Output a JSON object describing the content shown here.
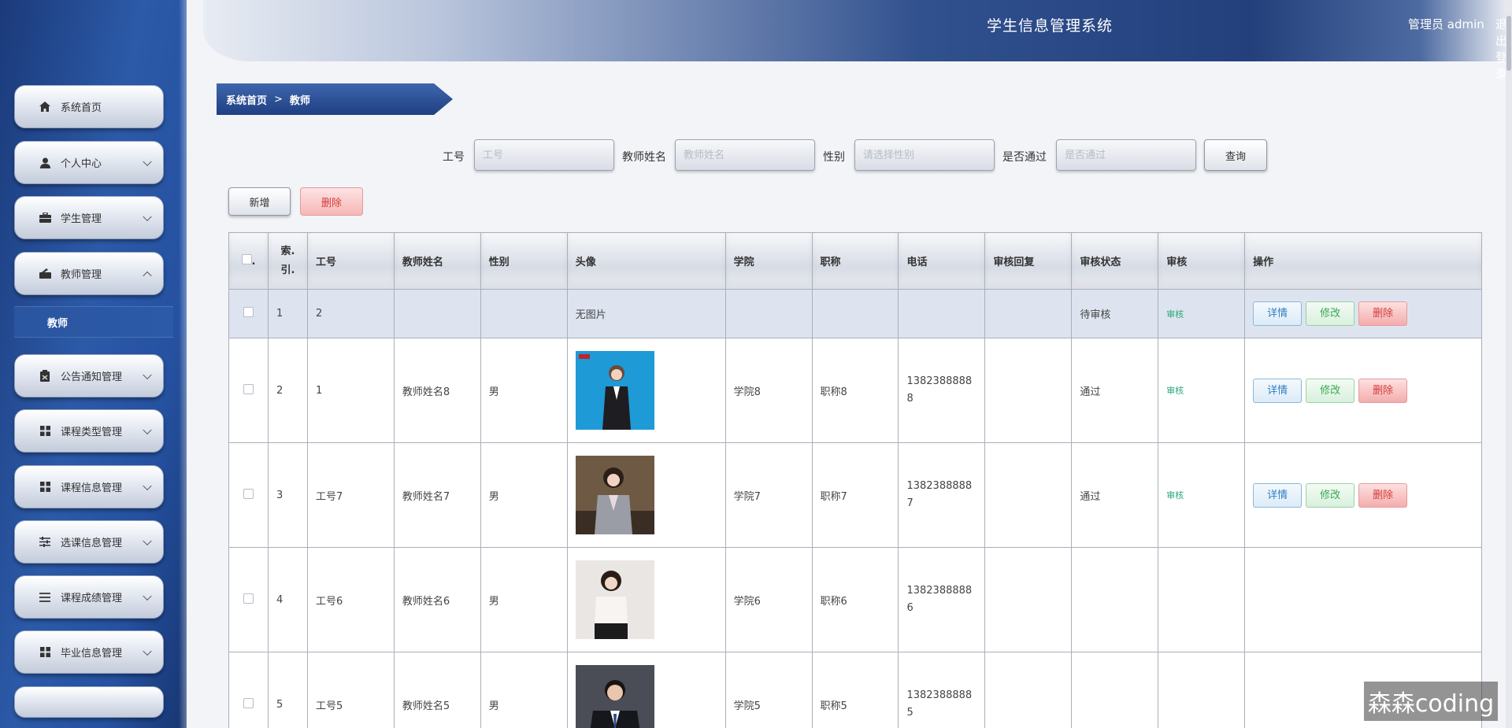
{
  "header": {
    "title": "学生信息管理系统",
    "user": "管理员 admin",
    "logout": "退出登录"
  },
  "sidebar": {
    "items": [
      {
        "label": "系统首页",
        "icon": "home-icon"
      },
      {
        "label": "个人中心",
        "icon": "user-icon"
      },
      {
        "label": "学生管理",
        "icon": "briefcase-icon"
      },
      {
        "label": "教师管理",
        "icon": "teacher-icon"
      },
      {
        "label": "公告通知管理",
        "icon": "clipboard-icon"
      },
      {
        "label": "课程类型管理",
        "icon": "grid-icon"
      },
      {
        "label": "课程信息管理",
        "icon": "grid-icon"
      },
      {
        "label": "选课信息管理",
        "icon": "sliders-icon"
      },
      {
        "label": "课程成绩管理",
        "icon": "list-icon"
      },
      {
        "label": "毕业信息管理",
        "icon": "grid-icon"
      }
    ],
    "submenu": "教师"
  },
  "breadcrumb": {
    "home": "系统首页",
    "separator": ">",
    "current": "教师"
  },
  "search": {
    "gonghao_label": "工号",
    "gonghao_placeholder": "工号",
    "name_label": "教师姓名",
    "name_placeholder": "教师姓名",
    "gender_label": "性别",
    "gender_placeholder": "请选择性别",
    "pass_label": "是否通过",
    "pass_placeholder": "是否通过",
    "query": "查询"
  },
  "toolbar": {
    "add": "新增",
    "delete": "删除"
  },
  "table": {
    "headers": [
      "索引",
      "工号",
      "教师姓名",
      "性别",
      "头像",
      "学院",
      "职称",
      "电话",
      "审核回复",
      "审核状态",
      "审核",
      "操作"
    ],
    "header_index_top": "索.",
    "header_index_bottom": "引.",
    "rows": [
      {
        "index": "1",
        "gonghao": "2",
        "name": "",
        "gender": "",
        "avatar": "无图片",
        "college": "",
        "title": "",
        "phone": "",
        "reply": "",
        "status": "待审核",
        "audit": "审核"
      },
      {
        "index": "2",
        "gonghao": "1",
        "name": "教师姓名8",
        "gender": "男",
        "avatar": "",
        "college": "学院8",
        "title": "职称8",
        "phone": "13823888888",
        "reply": "",
        "status": "通过",
        "audit": "审核"
      },
      {
        "index": "3",
        "gonghao": "工号7",
        "name": "教师姓名7",
        "gender": "男",
        "avatar": "",
        "college": "学院7",
        "title": "职称7",
        "phone": "13823888887",
        "reply": "",
        "status": "通过",
        "audit": "审核"
      },
      {
        "index": "4",
        "gonghao": "工号6",
        "name": "教师姓名6",
        "gender": "男",
        "avatar": "",
        "college": "学院6",
        "title": "职称6",
        "phone": "13823888886",
        "reply": "",
        "status": "",
        "audit": ""
      },
      {
        "index": "5",
        "gonghao": "工号5",
        "name": "教师姓名5",
        "gender": "男",
        "avatar": "",
        "college": "学院5",
        "title": "职称5",
        "phone": "13823888885",
        "reply": "",
        "status": "",
        "audit": ""
      }
    ],
    "actions": {
      "detail": "详情",
      "edit": "修改",
      "delete": "删除"
    }
  },
  "watermark": "森森coding"
}
